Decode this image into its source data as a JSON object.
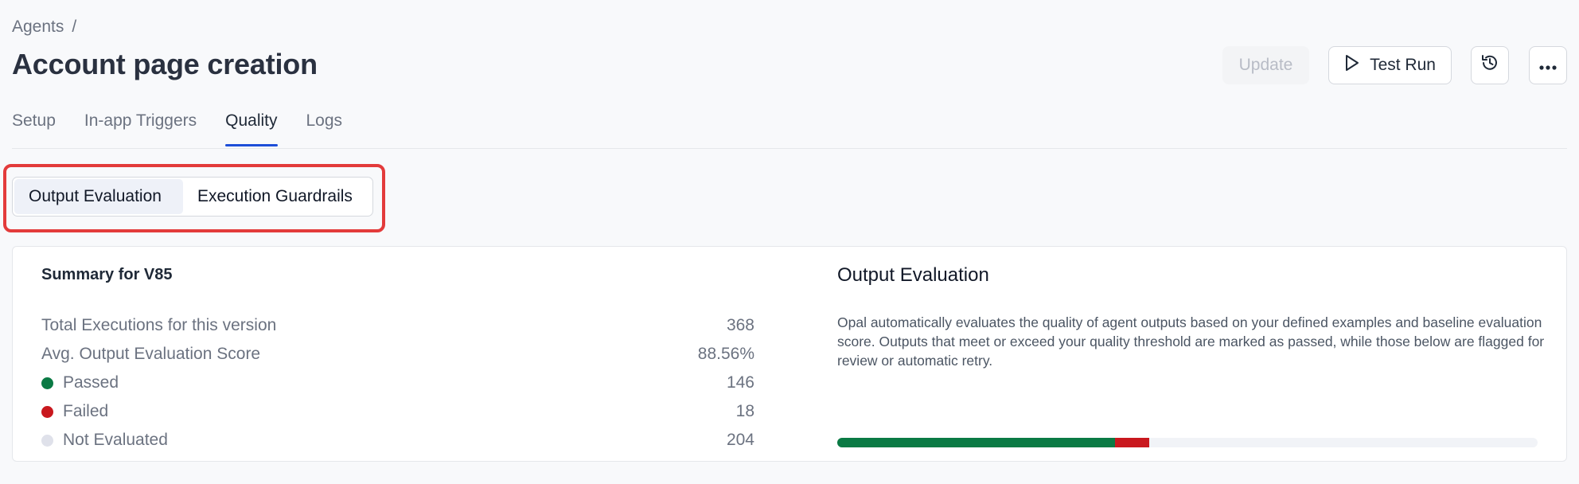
{
  "breadcrumb": {
    "root": "Agents",
    "separator": "/"
  },
  "page_title": "Account page creation",
  "actions": {
    "update_label": "Update",
    "test_run_label": "Test Run",
    "history_icon": "history-icon",
    "more_icon": "more-icon"
  },
  "tabs": [
    {
      "label": "Setup",
      "active": false
    },
    {
      "label": "In-app Triggers",
      "active": false
    },
    {
      "label": "Quality",
      "active": true
    },
    {
      "label": "Logs",
      "active": false
    }
  ],
  "subtabs": [
    {
      "label": "Output Evaluation",
      "active": true
    },
    {
      "label": "Execution Guardrails",
      "active": false
    }
  ],
  "summary": {
    "title": "Summary for V85",
    "rows": [
      {
        "label": "Total Executions for this version",
        "value": "368"
      },
      {
        "label": "Avg. Output Evaluation Score",
        "value": "88.56%"
      },
      {
        "label": "Passed",
        "value": "146",
        "color": "#0a7a44"
      },
      {
        "label": "Failed",
        "value": "18",
        "color": "#c9181e"
      },
      {
        "label": "Not Evaluated",
        "value": "204",
        "color": "#dfe1ea"
      }
    ]
  },
  "evaluation": {
    "title": "Output Evaluation",
    "description": "Opal automatically evaluates the quality of agent outputs based on your defined examples and baseline evaluation score. Outputs that meet or exceed your quality threshold are marked as passed, while those below are flagged for review or automatic retry.",
    "progress": {
      "passed": 146,
      "failed": 18,
      "not_evaluated": 204,
      "total": 368
    }
  },
  "colors": {
    "accent": "#1d4ed8",
    "passed": "#0a7a44",
    "failed": "#c9181e",
    "not_evaluated": "#dfe1ea",
    "highlight": "#e33b3b"
  }
}
